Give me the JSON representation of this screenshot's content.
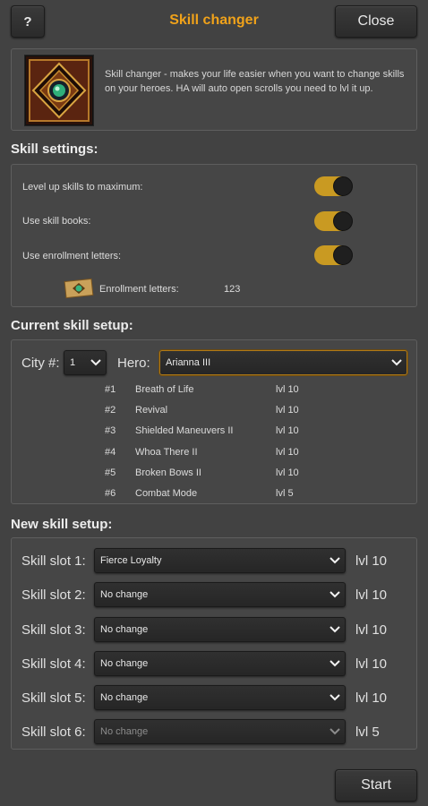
{
  "header": {
    "help_label": "?",
    "title": "Skill changer",
    "close_label": "Close"
  },
  "intro": {
    "description": "Skill changer - makes your life easier when you want to change skills on your heroes. HA will auto open scrolls you need to lvl it up."
  },
  "settings": {
    "section_title": "Skill settings:",
    "options": [
      {
        "label": "Level up skills to maximum:",
        "enabled": true
      },
      {
        "label": "Use skill books:",
        "enabled": true
      },
      {
        "label": "Use enrollment letters:",
        "enabled": true
      }
    ],
    "letters_label": "Enrollment letters:",
    "letters_count": "123"
  },
  "current": {
    "section_title": "Current skill setup:",
    "city_label": "City #:",
    "city_value": "1",
    "hero_label": "Hero:",
    "hero_value": "Arianna III",
    "skills": [
      {
        "num": "#1",
        "name": "Breath of Life",
        "level": "lvl 10"
      },
      {
        "num": "#2",
        "name": "Revival",
        "level": "lvl 10"
      },
      {
        "num": "#3",
        "name": "Shielded Maneuvers II",
        "level": "lvl 10"
      },
      {
        "num": "#4",
        "name": "Whoa There II",
        "level": "lvl 10"
      },
      {
        "num": "#5",
        "name": "Broken Bows II",
        "level": "lvl 10"
      },
      {
        "num": "#6",
        "name": "Combat Mode",
        "level": "lvl 5"
      }
    ]
  },
  "new_setup": {
    "section_title": "New skill setup:",
    "slots": [
      {
        "label": "Skill slot 1:",
        "value": "Fierce Loyalty",
        "level": "lvl 10",
        "disabled": false
      },
      {
        "label": "Skill slot 2:",
        "value": "No change",
        "level": "lvl 10",
        "disabled": false
      },
      {
        "label": "Skill slot 3:",
        "value": "No change",
        "level": "lvl 10",
        "disabled": false
      },
      {
        "label": "Skill slot 4:",
        "value": "No change",
        "level": "lvl 10",
        "disabled": false
      },
      {
        "label": "Skill slot 5:",
        "value": "No change",
        "level": "lvl 10",
        "disabled": false
      },
      {
        "label": "Skill slot 6:",
        "value": "No change",
        "level": "lvl 5",
        "disabled": true
      }
    ]
  },
  "footer": {
    "start_label": "Start"
  },
  "colors": {
    "accent": "#f0a21a",
    "toggle_on": "#c99a22",
    "background": "#424242"
  }
}
